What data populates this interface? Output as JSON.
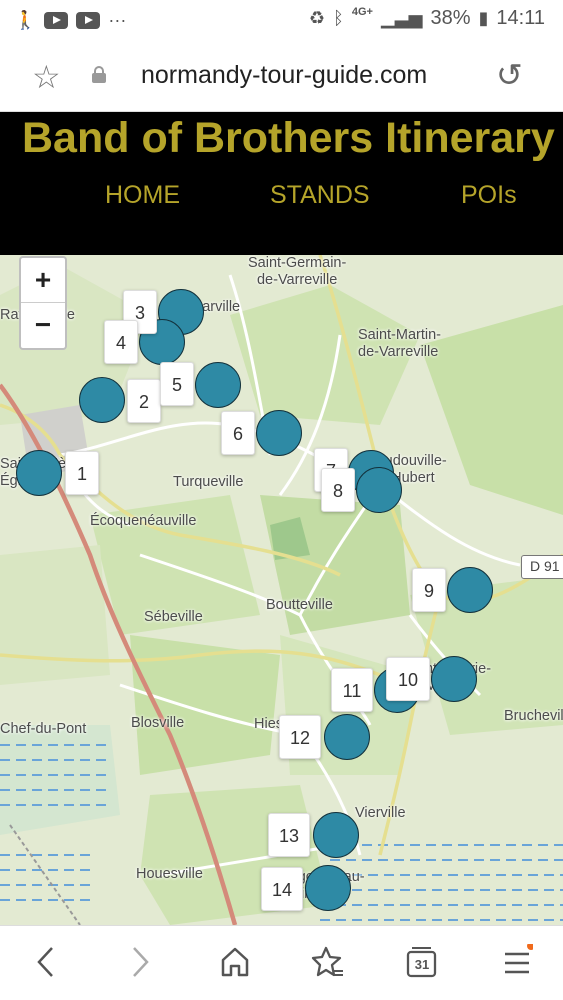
{
  "statusbar": {
    "battery": "38%",
    "time": "14:11",
    "network": "4G+"
  },
  "browser": {
    "url": "normandy-tour-guide.com"
  },
  "header": {
    "title": "Band of Brothers Itinerary",
    "nav": [
      "HOME",
      "STANDS",
      "POIs"
    ]
  },
  "map": {
    "zoom_in": "+",
    "zoom_out": "−",
    "road": "D 91",
    "places": [
      "Saint-Germain-\nde-Varreville",
      "Saint-Martin-\nde-Varreville",
      "Turqueville",
      "Écoquenéauville",
      "Sébeville",
      "Boutteville",
      "Blosville",
      "Hiesville",
      "Vierville",
      "Houesville",
      "Brucheville",
      "Audouville-\nla-Hubert",
      "Sainte-Marie-\ndu-Mont",
      "Sainte-Mère-\nÉglise",
      "Angoville-au-\nPlain",
      "Ravenoville",
      "Foucarville",
      "Chef-du-Pont"
    ],
    "stands": [
      "1",
      "2",
      "3",
      "4",
      "5",
      "6",
      "7",
      "8",
      "9",
      "10",
      "11",
      "12",
      "13",
      "14"
    ],
    "colors": {
      "marker": "#2e8aa5",
      "title": "#b5a42a"
    }
  },
  "bottom_nav": [
    "back",
    "forward",
    "home",
    "bookmarks",
    "tabs",
    "menu"
  ],
  "tabs_count": "31"
}
